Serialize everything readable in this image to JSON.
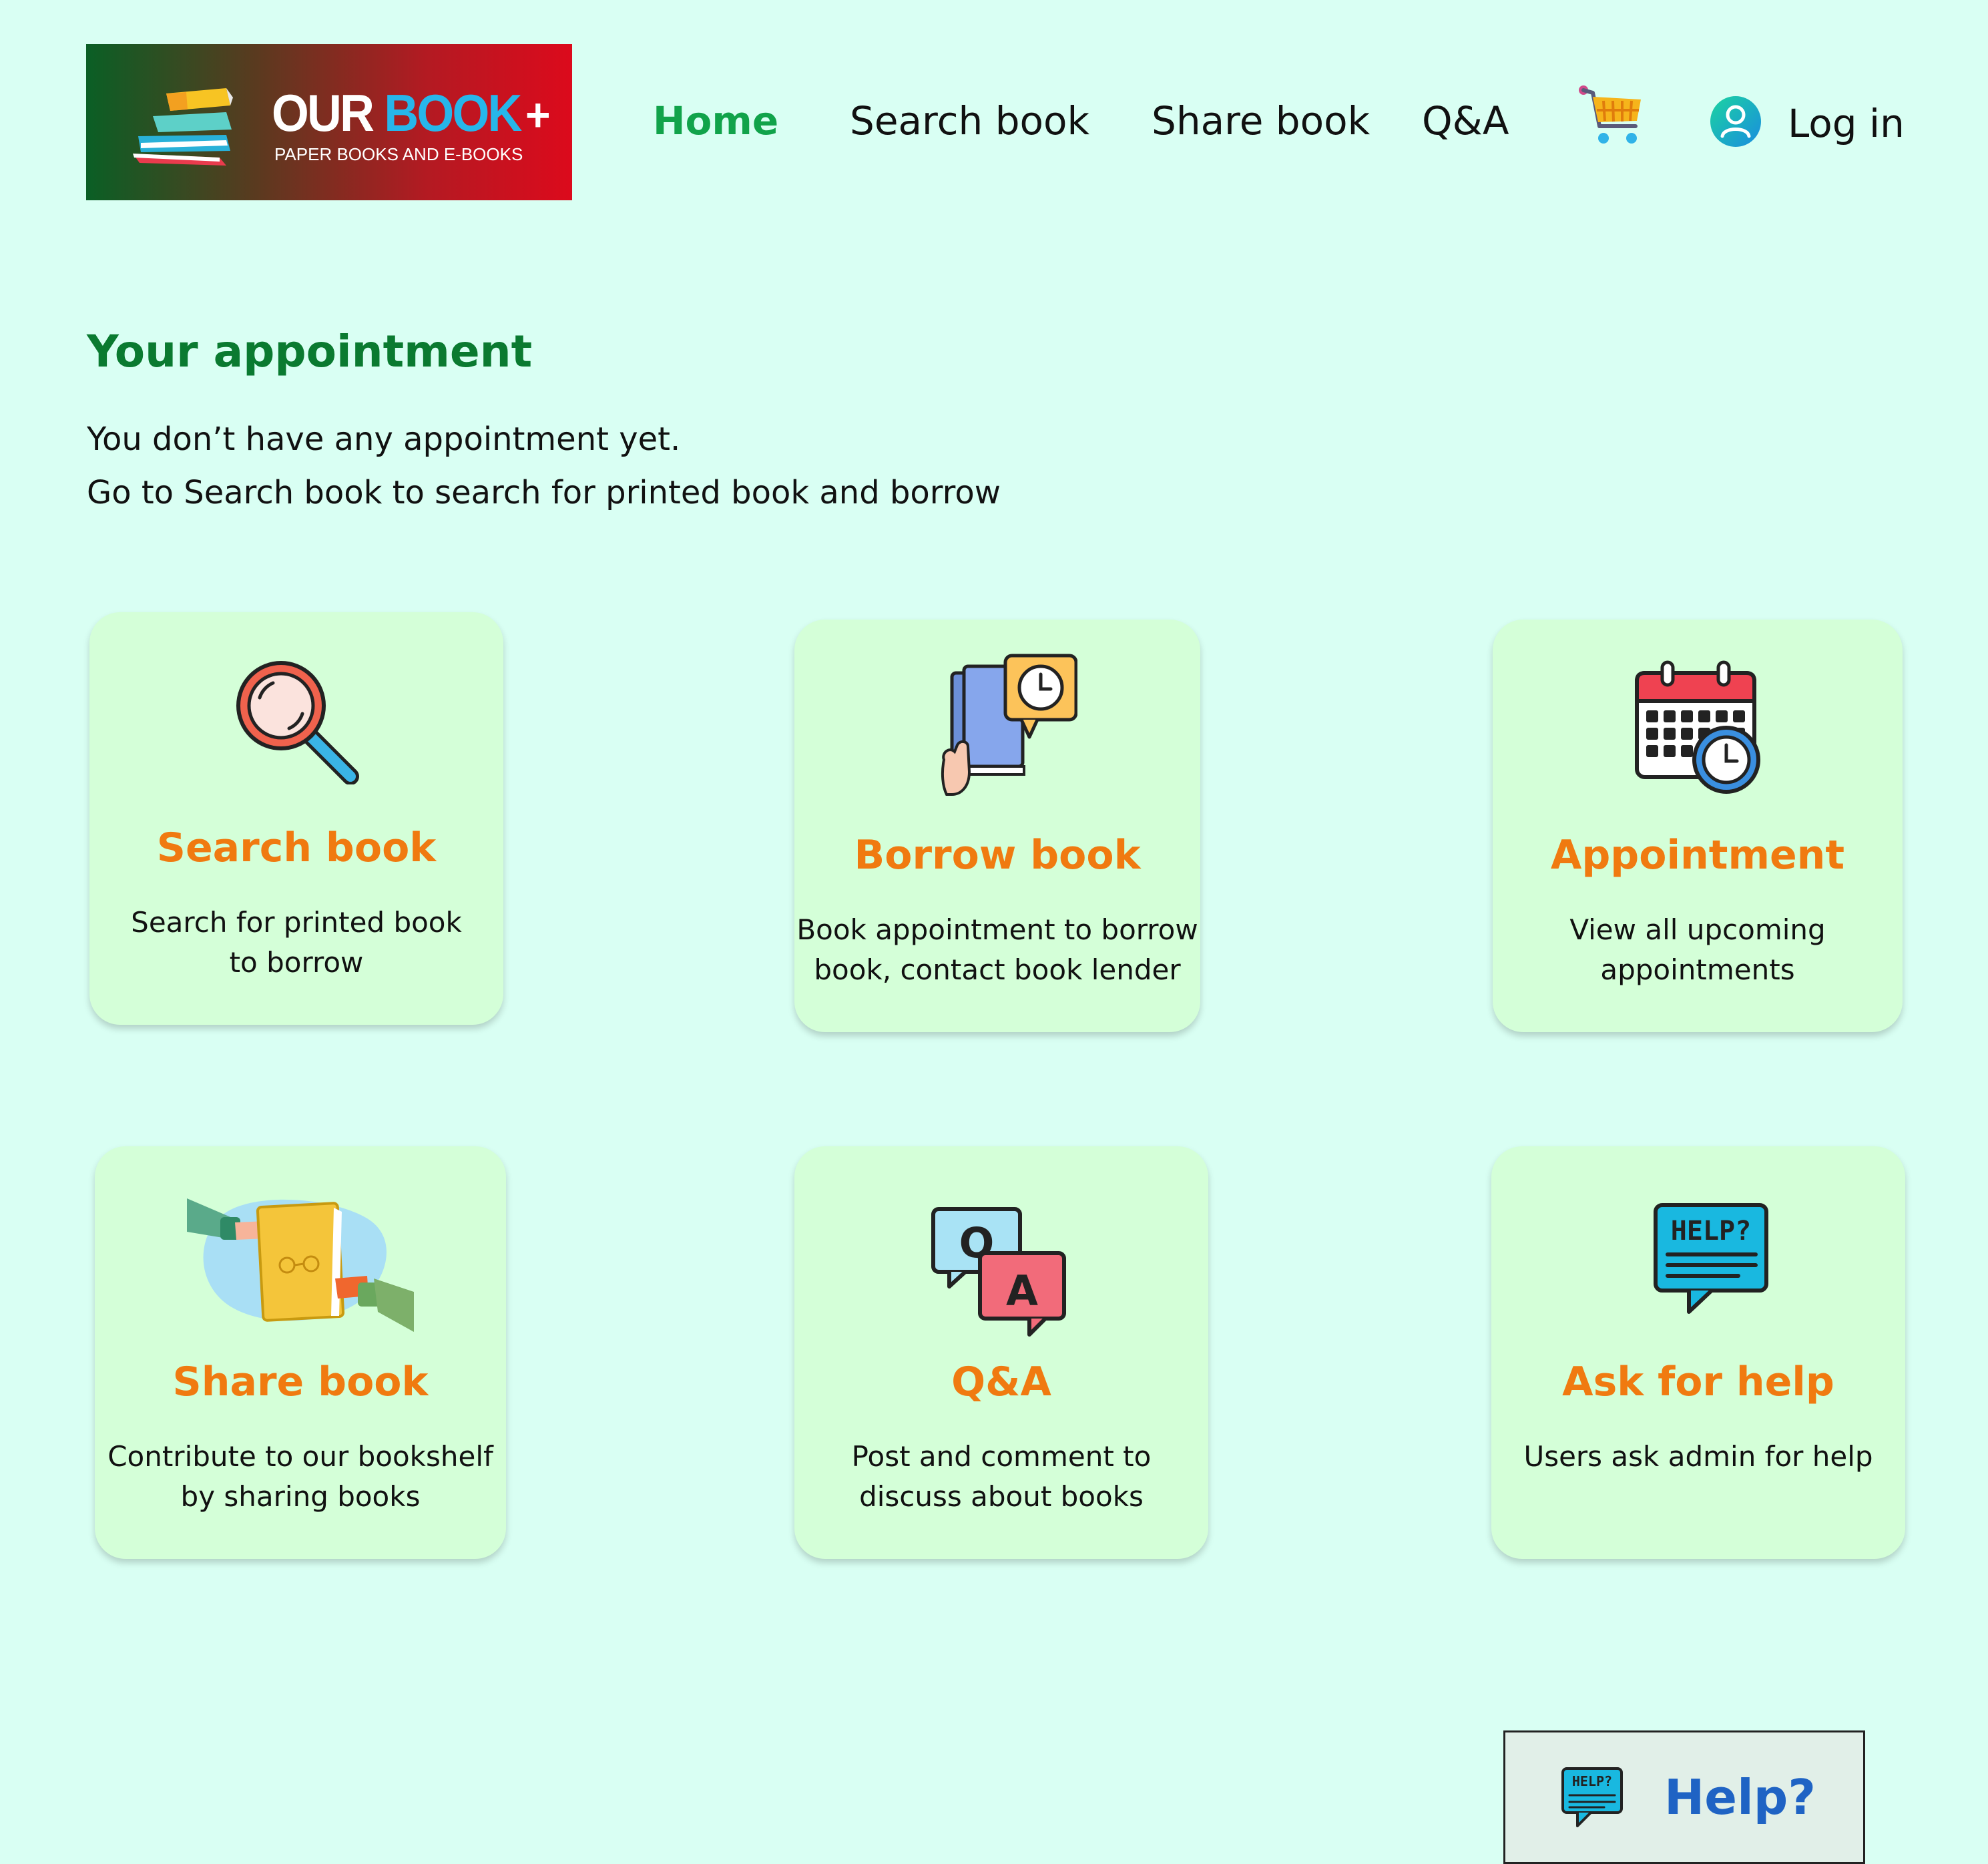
{
  "header": {
    "logo": {
      "title_part1": "OUR ",
      "title_part2": "BOOK",
      "title_plus": "+",
      "subtitle": "PAPER BOOKS AND E-BOOKS"
    },
    "nav": {
      "home": "Home",
      "search": "Search book",
      "share": "Share book",
      "qa": "Q&A",
      "login": "Log in"
    },
    "active_color": "#11a34a"
  },
  "appointment": {
    "title": "Your appointment",
    "line1": "You don’t have any appointment yet.",
    "line2": "Go to Search book to search for printed book and borrow"
  },
  "cards": [
    {
      "title": "Search book",
      "desc_line1": "Search for printed book",
      "desc_line2": "to borrow",
      "icon": "magnifier-icon"
    },
    {
      "title": "Borrow book",
      "desc_line1": "Book appointment to borrow",
      "desc_line2": "book, contact book lender",
      "icon": "book-clock-icon"
    },
    {
      "title": "Appointment",
      "desc_line1": "View all upcoming",
      "desc_line2": "appointments",
      "icon": "calendar-clock-icon"
    },
    {
      "title": "Share book",
      "desc_line1": "Contribute to our bookshelf",
      "desc_line2": "by sharing books",
      "icon": "share-book-icon"
    },
    {
      "title": "Q&A",
      "desc_line1": "Post and comment to",
      "desc_line2": "discuss about books",
      "icon": "qa-bubbles-icon"
    },
    {
      "title": "Ask for help",
      "desc_line1": "Users ask admin for help",
      "desc_line2": "",
      "icon": "help-bubble-icon"
    }
  ],
  "help_widget": {
    "label": "Help?",
    "icon_text": "HELP?"
  },
  "colors": {
    "background": "#d9fff3",
    "card": "#d4ffd8",
    "card_title": "#f07a10",
    "section_title": "#0a7a30",
    "help_label": "#1f63c4"
  }
}
